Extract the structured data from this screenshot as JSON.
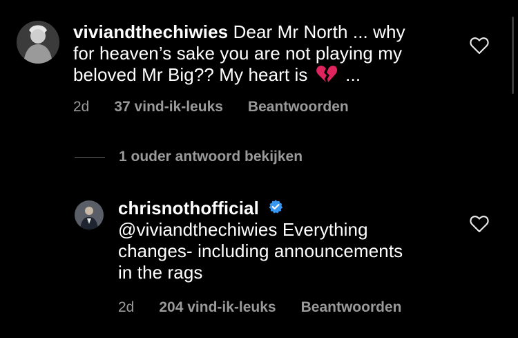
{
  "comments": [
    {
      "username": "viviandthechiwies",
      "text_line1": "Dear Mr North ... why",
      "text_line2": "for heaven’s sake you are not playing my",
      "text_line3_before": "beloved Mr Big?? My heart is",
      "text_line3_after": "...",
      "emoji": "broken-heart",
      "age": "2d",
      "likes": "37 vind-ik-leuks",
      "reply_label": "Beantwoorden"
    },
    {
      "username": "chrisnothofficial",
      "verified": true,
      "text_line1": "@viviandthechiwies Everything",
      "text_line2": "changes- including announcements",
      "text_line3": "in the rags",
      "age": "2d",
      "likes": "204 vind-ik-leuks",
      "reply_label": "Beantwoorden"
    }
  ],
  "thread": {
    "view_replies_label": "1 ouder antwoord bekijken"
  },
  "colors": {
    "background": "#000000",
    "text": "#ffffff",
    "meta": "#9a9a9a",
    "verified": "#3897f0",
    "heart_emoji": "#e0245e"
  }
}
